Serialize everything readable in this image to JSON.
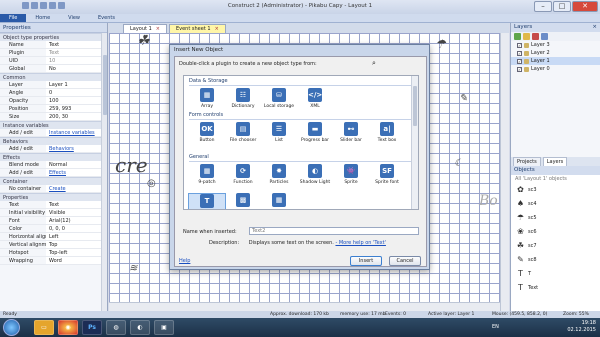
{
  "window": {
    "title": "Construct 2 (Administrator) - Pikabu Capy - Layout 1"
  },
  "ribbon": {
    "tabs": [
      "File",
      "Home",
      "View",
      "Events"
    ]
  },
  "doc_tabs": {
    "layout": "Layout 1",
    "event": "Event sheet 1"
  },
  "properties": {
    "sections": [
      {
        "title": "Object type properties",
        "rows": [
          {
            "k": "Name",
            "v": "Text"
          },
          {
            "k": "Plugin",
            "v": "Text",
            "gray": true
          },
          {
            "k": "UID",
            "v": "10",
            "gray": true
          },
          {
            "k": "Global",
            "v": "No"
          }
        ]
      },
      {
        "title": "Common",
        "rows": [
          {
            "k": "Layer",
            "v": "Layer 1"
          },
          {
            "k": "Angle",
            "v": "0"
          },
          {
            "k": "Opacity",
            "v": "100"
          },
          {
            "k": "Position",
            "v": "259, 993"
          },
          {
            "k": "Size",
            "v": "200, 30"
          }
        ]
      },
      {
        "title": "Instance variables",
        "rows": [
          {
            "k": "Add / edit",
            "v": "Instance variables",
            "link": true
          }
        ]
      },
      {
        "title": "Behaviors",
        "rows": [
          {
            "k": "Add / edit",
            "v": "Behaviors",
            "link": true
          }
        ]
      },
      {
        "title": "Effects",
        "rows": [
          {
            "k": "Blend mode",
            "v": "Normal"
          },
          {
            "k": "Add / edit",
            "v": "Effects",
            "link": true
          }
        ]
      },
      {
        "title": "Container",
        "rows": [
          {
            "k": "No container",
            "v": "Create",
            "link": true
          }
        ]
      },
      {
        "title": "Properties",
        "rows": [
          {
            "k": "Text",
            "v": "Text"
          },
          {
            "k": "Initial visibility",
            "v": "Visible"
          },
          {
            "k": "Font",
            "v": "Arial(12)"
          },
          {
            "k": "Color",
            "v": "0, 0, 0"
          },
          {
            "k": "Horizontal align...",
            "v": "Left"
          },
          {
            "k": "Vertical alignment",
            "v": "Top"
          },
          {
            "k": "Hotspot",
            "v": "Top-left"
          },
          {
            "k": "Wrapping",
            "v": "Word"
          }
        ]
      }
    ]
  },
  "layers": {
    "title": "Layers",
    "items": [
      {
        "name": "Layer 3",
        "checked": true
      },
      {
        "name": "Layer 2",
        "checked": true
      },
      {
        "name": "Layer 1",
        "checked": true,
        "selected": true
      },
      {
        "name": "Layer 0",
        "checked": true
      }
    ]
  },
  "panel_tabs": [
    "Projects",
    "Layers"
  ],
  "objects": {
    "title": "Objects",
    "filter": "All 'Layout 1' objects",
    "items": [
      "sc3",
      "sc4",
      "sc5",
      "sc6",
      "sc7",
      "sc8",
      "T",
      "Text"
    ]
  },
  "dialog": {
    "title": "Insert New Object",
    "instruction": "Double-click a plugin to create a new object type from:",
    "categories": [
      {
        "name": "Data & Storage",
        "plugins": [
          {
            "label": "Array",
            "icon": "array-icon",
            "glyph": "▦",
            "color": "#3b6fb6"
          },
          {
            "label": "Dictionary",
            "icon": "dictionary-icon",
            "glyph": "☷",
            "color": "#3b6fb6"
          },
          {
            "label": "Local storage",
            "icon": "local-storage-icon",
            "glyph": "⛁",
            "color": "#3b6fb6"
          },
          {
            "label": "XML",
            "icon": "xml-icon",
            "glyph": "</>",
            "color": "#3b6fb6"
          }
        ]
      },
      {
        "name": "Form controls",
        "plugins": [
          {
            "label": "Button",
            "icon": "button-icon",
            "glyph": "OK",
            "color": "#3b6fb6"
          },
          {
            "label": "File chooser",
            "icon": "file-chooser-icon",
            "glyph": "▤",
            "color": "#3b6fb6"
          },
          {
            "label": "List",
            "icon": "list-icon",
            "glyph": "☰",
            "color": "#3b6fb6"
          },
          {
            "label": "Progress bar",
            "icon": "progress-bar-icon",
            "glyph": "▬",
            "color": "#3b6fb6"
          },
          {
            "label": "Slider bar",
            "icon": "slider-bar-icon",
            "glyph": "⊷",
            "color": "#3b6fb6"
          },
          {
            "label": "Text box",
            "icon": "text-box-icon",
            "glyph": "a|",
            "color": "#3b6fb6"
          }
        ]
      },
      {
        "name": "General",
        "plugins": [
          {
            "label": "9-patch",
            "icon": "nine-patch-icon",
            "glyph": "▦",
            "color": "#3b6fb6"
          },
          {
            "label": "Function",
            "icon": "function-icon",
            "glyph": "⟳",
            "color": "#3b6fb6"
          },
          {
            "label": "Particles",
            "icon": "particles-icon",
            "glyph": "✸",
            "color": "#3b6fb6"
          },
          {
            "label": "Shadow Light",
            "icon": "shadow-light-icon",
            "glyph": "◐",
            "color": "#3b6fb6"
          },
          {
            "label": "Sprite",
            "icon": "sprite-icon",
            "glyph": "👾",
            "color": "#3b6fb6"
          },
          {
            "label": "Sprite font",
            "icon": "sprite-font-icon",
            "glyph": "SF",
            "color": "#3b6fb6"
          },
          {
            "label": "Text",
            "icon": "text-icon",
            "glyph": "T",
            "color": "#3b6fb6",
            "selected": true
          },
          {
            "label": "",
            "icon": "tiled-background-icon",
            "glyph": "▩",
            "color": "#3b6fb6"
          },
          {
            "label": "",
            "icon": "tilemap-icon",
            "glyph": "▦",
            "color": "#3b6fb6"
          }
        ]
      }
    ],
    "name_label": "Name when inserted:",
    "name_value": "Text2",
    "desc_label": "Description:",
    "desc_text": "Displays some text on the screen.",
    "desc_link": "- More help on 'Text'",
    "help": "Help",
    "insert": "Insert",
    "cancel": "Cancel"
  },
  "status": {
    "left": "Ready",
    "download": "Approx. download: 170 kb",
    "memory": "memory use: 17 mb",
    "events": "Events: 0",
    "layer": "Active layer: Layer 1",
    "mouse": "Mouse: (459.5, 858.2, 0)",
    "zoom": "Zoom: 55%"
  },
  "taskbar": {
    "lang": "EN",
    "time": "19:18",
    "date": "02.12.2015"
  }
}
